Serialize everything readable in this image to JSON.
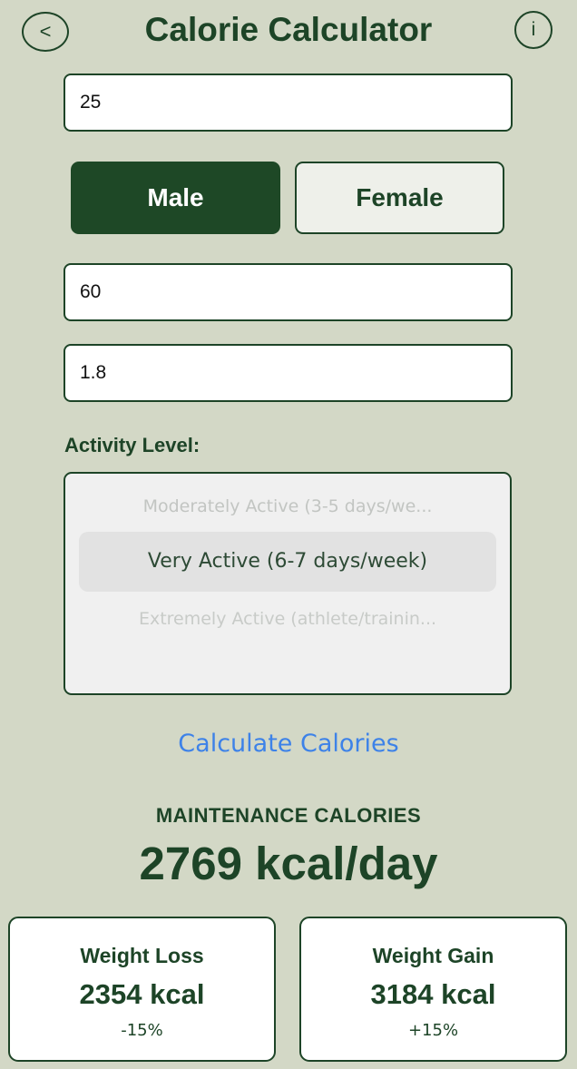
{
  "header": {
    "back_icon": "<",
    "title": "Calorie Calculator",
    "info_icon": "i"
  },
  "form": {
    "age_value": "25",
    "gender": {
      "male_label": "Male",
      "female_label": "Female",
      "selected": "Male"
    },
    "weight_value": "60",
    "height_value": "1.8",
    "activity_label": "Activity Level:",
    "activity_options": {
      "above": "Moderately Active (3-5 days/we...",
      "selected": "Very Active (6-7 days/week)",
      "below": "Extremely Active (athlete/trainin..."
    }
  },
  "actions": {
    "calculate_label": "Calculate Calories"
  },
  "results": {
    "maintenance_label": "MAINTENANCE CALORIES",
    "maintenance_value": "2769 kcal/day",
    "loss": {
      "title": "Weight Loss",
      "value": "2354 kcal",
      "pct": "-15%"
    },
    "gain": {
      "title": "Weight Gain",
      "value": "3184 kcal",
      "pct": "+15%"
    }
  },
  "colors": {
    "background": "#d3d8c6",
    "primary_green": "#1d4427",
    "link_blue": "#3d82e8"
  }
}
